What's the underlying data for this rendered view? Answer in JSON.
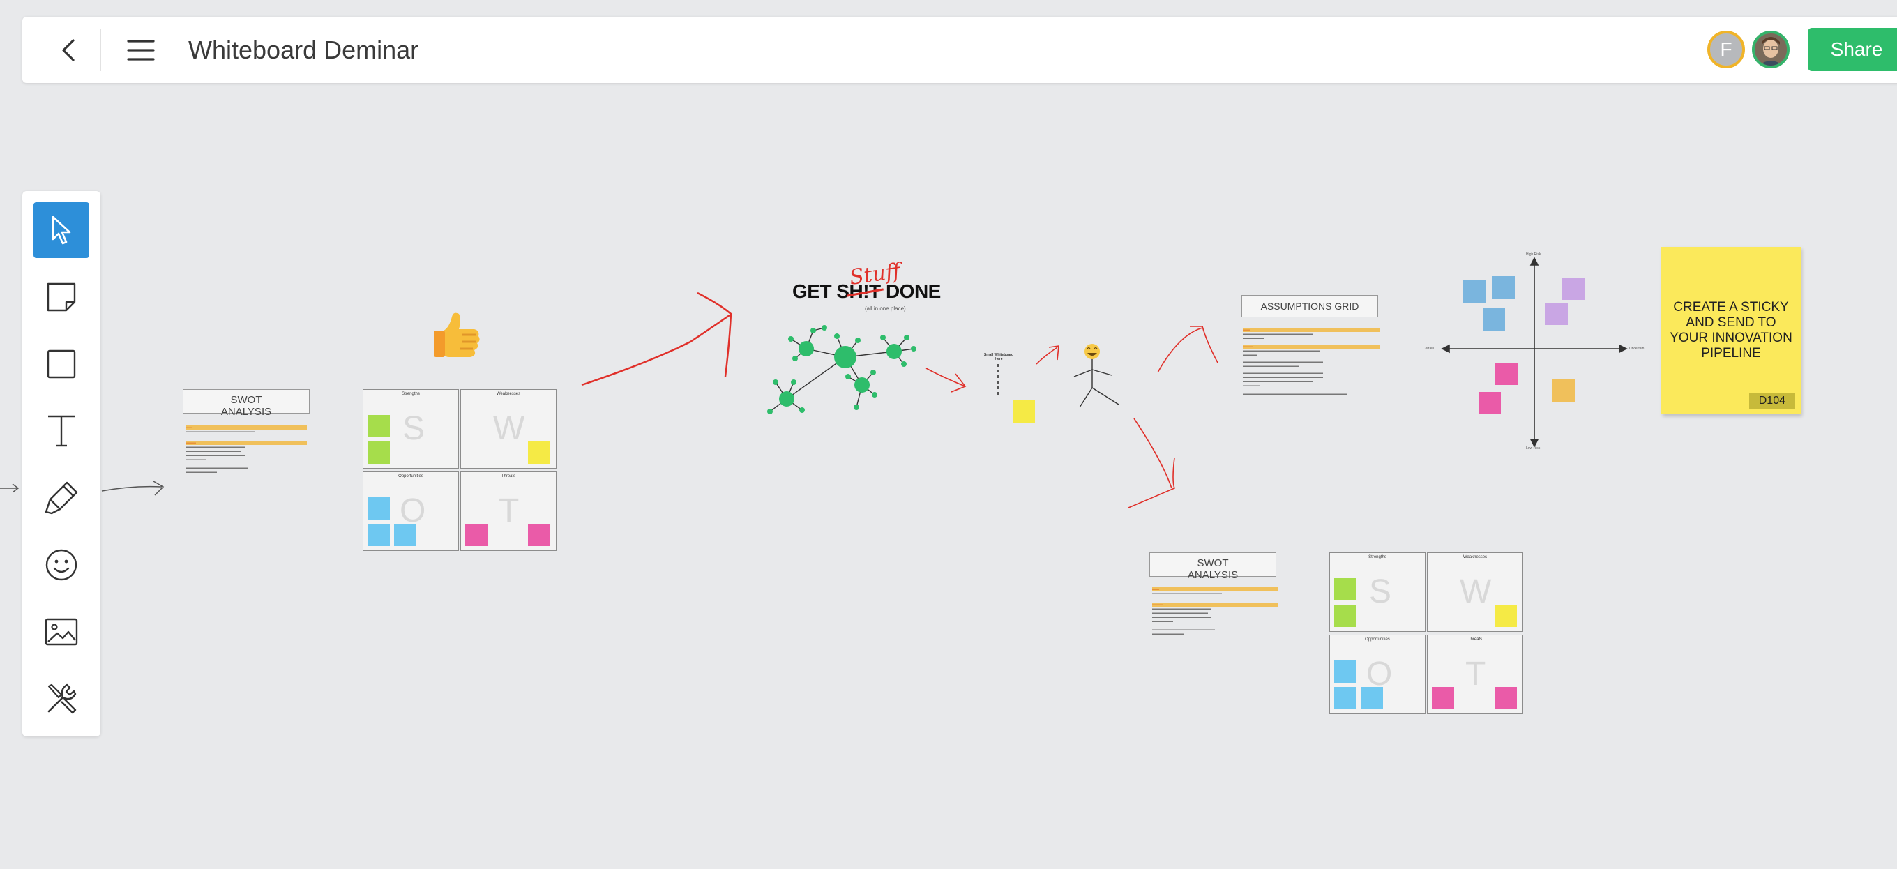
{
  "header": {
    "title": "Whiteboard Deminar",
    "avatar_initial": "F",
    "share_label": "Share"
  },
  "toolbar": {
    "tools": [
      "select",
      "sticky-note",
      "shape",
      "text",
      "pen",
      "emoji",
      "image",
      "more-tools"
    ],
    "active_tool": "select",
    "accent": "#2d8fd9"
  },
  "colors": {
    "share": "#2ebd6b",
    "canvas": "#e8e9eb",
    "avatar_ring_1": "#f0b429",
    "avatar_ring_2": "#35b36b"
  },
  "canvas": {
    "swot1": {
      "title_line1": "SWOT",
      "title_line2": "ANALYSIS",
      "quadrants": [
        "Strengths",
        "Weaknesses",
        "Opportunities",
        "Threats"
      ],
      "letters": [
        "S",
        "W",
        "O",
        "T"
      ]
    },
    "swot2": {
      "title_line1": "SWOT",
      "title_line2": "ANALYSIS",
      "quadrants": [
        "Strengths",
        "Weaknesses",
        "Opportunities",
        "Threats"
      ],
      "letters": [
        "S",
        "W",
        "O",
        "T"
      ]
    },
    "gsd": {
      "title_left": "GET S",
      "title_strike": "H!T",
      "title_right": " DONE",
      "overwrite": "Stuff",
      "subtitle": "(all in one place)"
    },
    "assumptions": {
      "title": "ASSUMPTIONS GRID",
      "axis_top": "High Risk",
      "axis_bottom": "Low Risk",
      "axis_left": "Certain",
      "axis_right": "Uncertain"
    },
    "big_sticky": {
      "text": "CREATE A STICKY AND SEND TO YOUR INNOVATION PIPELINE",
      "code": "D104"
    },
    "small_whiteboard_label": "Small Whiteboard Here"
  }
}
